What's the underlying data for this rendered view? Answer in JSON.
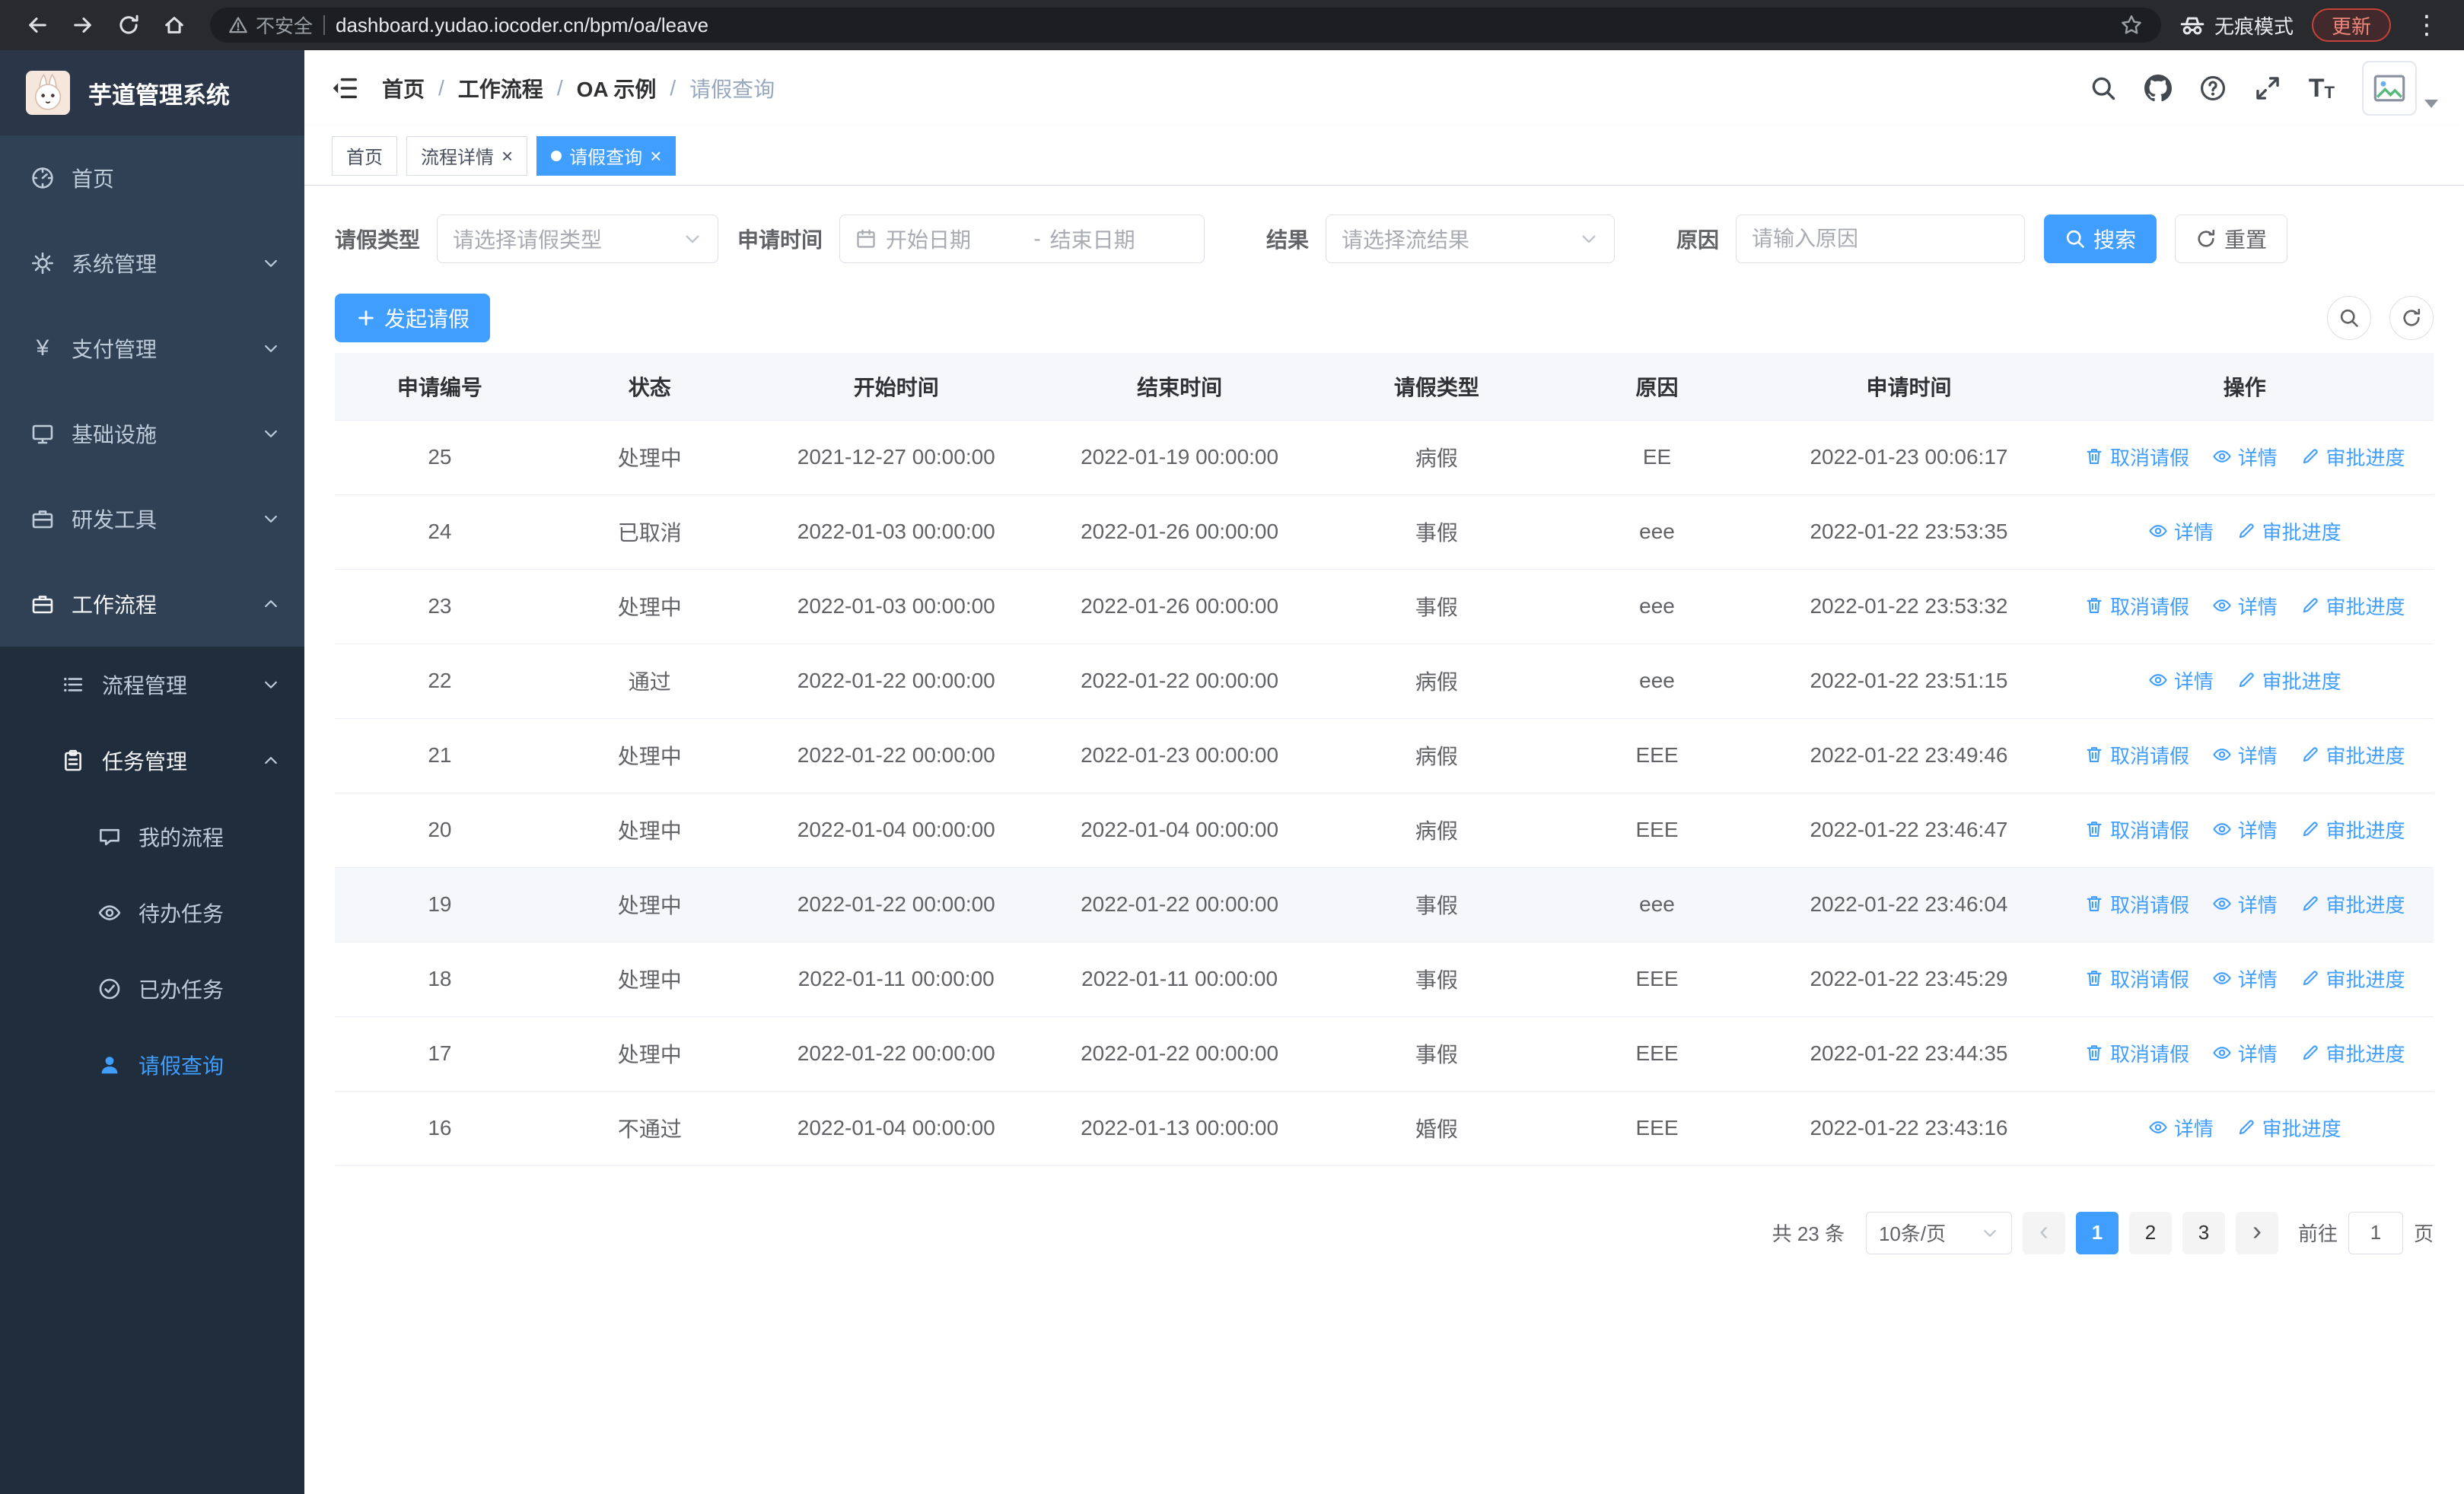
{
  "browser": {
    "security_label": "不安全",
    "url": "dashboard.yudao.iocoder.cn/bpm/oa/leave",
    "incognito_label": "无痕模式",
    "update_label": "更新"
  },
  "sidebar": {
    "logo_title": "芋道管理系统",
    "items": [
      {
        "label": "首页",
        "icon": "dashboard-icon"
      },
      {
        "label": "系统管理",
        "icon": "gear-icon",
        "chevron": "down"
      },
      {
        "label": "支付管理",
        "icon": "yen-icon",
        "chevron": "down"
      },
      {
        "label": "基础设施",
        "icon": "monitor-icon",
        "chevron": "down"
      },
      {
        "label": "研发工具",
        "icon": "briefcase-icon",
        "chevron": "down"
      },
      {
        "label": "工作流程",
        "icon": "suitcase-icon",
        "chevron": "up",
        "expanded": true
      }
    ],
    "submenu": [
      {
        "label": "流程管理",
        "icon": "list-icon",
        "chevron": "down"
      },
      {
        "label": "任务管理",
        "icon": "clipboard-icon",
        "chevron": "up",
        "expanded": true
      }
    ],
    "tasks_children": [
      {
        "label": "我的流程",
        "icon": "chat-bubble-icon"
      },
      {
        "label": "待办任务",
        "icon": "eye-icon"
      },
      {
        "label": "已办任务",
        "icon": "check-circle-icon"
      },
      {
        "label": "请假查询",
        "icon": "user-icon",
        "active": true
      }
    ]
  },
  "header": {
    "breadcrumb": [
      "首页",
      "工作流程",
      "OA 示例",
      "请假查询"
    ],
    "right_icons": [
      "search-icon",
      "github-icon",
      "help-icon",
      "fullscreen-icon",
      "font-size-icon",
      "avatar"
    ]
  },
  "tabs": [
    {
      "label": "首页",
      "closable": false,
      "active": false
    },
    {
      "label": "流程详情",
      "closable": true,
      "active": false
    },
    {
      "label": "请假查询",
      "closable": true,
      "active": true
    }
  ],
  "filters": {
    "leave_type_label": "请假类型",
    "leave_type_placeholder": "请选择请假类型",
    "apply_time_label": "申请时间",
    "start_date_placeholder": "开始日期",
    "range_separator": "-",
    "end_date_placeholder": "结束日期",
    "result_label": "结果",
    "result_placeholder": "请选择流结果",
    "reason_label": "原因",
    "reason_placeholder": "请输入原因",
    "search_button": "搜索",
    "reset_button": "重置"
  },
  "toolbar": {
    "create_button": "发起请假",
    "right_icons": [
      "search-toggle-icon",
      "refresh-icon"
    ]
  },
  "table": {
    "columns": [
      "申请编号",
      "状态",
      "开始时间",
      "结束时间",
      "请假类型",
      "原因",
      "申请时间",
      "操作"
    ],
    "actions": {
      "cancel": "取消请假",
      "detail": "详情",
      "progress": "审批进度"
    },
    "rows": [
      {
        "id": "25",
        "status": "处理中",
        "start": "2021-12-27 00:00:00",
        "end": "2022-01-19 00:00:00",
        "type": "病假",
        "reason": "EE",
        "apply_time": "2022-01-23 00:06:17",
        "cancelable": true
      },
      {
        "id": "24",
        "status": "已取消",
        "start": "2022-01-03 00:00:00",
        "end": "2022-01-26 00:00:00",
        "type": "事假",
        "reason": "eee",
        "apply_time": "2022-01-22 23:53:35",
        "cancelable": false
      },
      {
        "id": "23",
        "status": "处理中",
        "start": "2022-01-03 00:00:00",
        "end": "2022-01-26 00:00:00",
        "type": "事假",
        "reason": "eee",
        "apply_time": "2022-01-22 23:53:32",
        "cancelable": true
      },
      {
        "id": "22",
        "status": "通过",
        "start": "2022-01-22 00:00:00",
        "end": "2022-01-22 00:00:00",
        "type": "病假",
        "reason": "eee",
        "apply_time": "2022-01-22 23:51:15",
        "cancelable": false
      },
      {
        "id": "21",
        "status": "处理中",
        "start": "2022-01-22 00:00:00",
        "end": "2022-01-23 00:00:00",
        "type": "病假",
        "reason": "EEE",
        "apply_time": "2022-01-22 23:49:46",
        "cancelable": true
      },
      {
        "id": "20",
        "status": "处理中",
        "start": "2022-01-04 00:00:00",
        "end": "2022-01-04 00:00:00",
        "type": "病假",
        "reason": "EEE",
        "apply_time": "2022-01-22 23:46:47",
        "cancelable": true
      },
      {
        "id": "19",
        "status": "处理中",
        "start": "2022-01-22 00:00:00",
        "end": "2022-01-22 00:00:00",
        "type": "事假",
        "reason": "eee",
        "apply_time": "2022-01-22 23:46:04",
        "cancelable": true,
        "highlight": true
      },
      {
        "id": "18",
        "status": "处理中",
        "start": "2022-01-11 00:00:00",
        "end": "2022-01-11 00:00:00",
        "type": "事假",
        "reason": "EEE",
        "apply_time": "2022-01-22 23:45:29",
        "cancelable": true
      },
      {
        "id": "17",
        "status": "处理中",
        "start": "2022-01-22 00:00:00",
        "end": "2022-01-22 00:00:00",
        "type": "事假",
        "reason": "EEE",
        "apply_time": "2022-01-22 23:44:35",
        "cancelable": true
      },
      {
        "id": "16",
        "status": "不通过",
        "start": "2022-01-04 00:00:00",
        "end": "2022-01-13 00:00:00",
        "type": "婚假",
        "reason": "EEE",
        "apply_time": "2022-01-22 23:43:16",
        "cancelable": false
      }
    ]
  },
  "pagination": {
    "total_text": "共 23 条",
    "page_size": "10条/页",
    "pages": [
      "1",
      "2",
      "3"
    ],
    "active_page": "1",
    "goto_label": "前往",
    "goto_value": "1",
    "goto_suffix": "页"
  },
  "colors": {
    "primary": "#409eff",
    "sidebar_bg": "#304156",
    "submenu_bg": "#1f2d3d"
  }
}
